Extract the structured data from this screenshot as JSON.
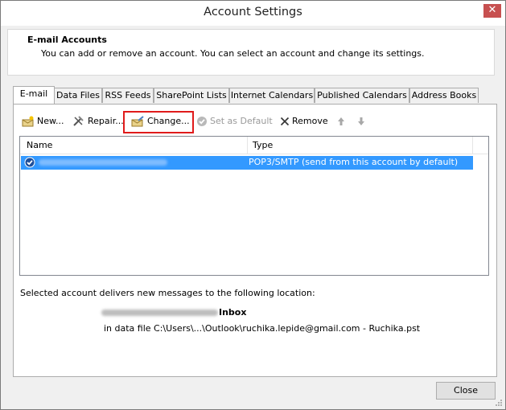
{
  "window": {
    "title": "Account Settings",
    "close_glyph": "✕"
  },
  "header": {
    "title": "E-mail Accounts",
    "description": "You can add or remove an account. You can select an account and change its settings."
  },
  "tabs": [
    {
      "label": "E-mail",
      "active": true
    },
    {
      "label": "Data Files"
    },
    {
      "label": "RSS Feeds"
    },
    {
      "label": "SharePoint Lists"
    },
    {
      "label": "Internet Calendars"
    },
    {
      "label": "Published Calendars"
    },
    {
      "label": "Address Books"
    }
  ],
  "toolbar": {
    "new_label": "New...",
    "repair_label": "Repair...",
    "change_label": "Change...",
    "set_default_label": "Set as Default",
    "remove_label": "Remove"
  },
  "accounts_list": {
    "columns": [
      "Name",
      "Type"
    ],
    "rows": [
      {
        "name": "ruchika.lepide@gmail.com",
        "type": "POP3/SMTP (send from this account by default)",
        "selected": true
      }
    ]
  },
  "delivery": {
    "text": "Selected account delivers new messages to the following location:",
    "mailbox": "ruchika.lepide@gmail.com",
    "folder": "Inbox",
    "data_file": "in data file C:\\Users\\...\\Outlook\\ruchika.lepide@gmail.com - Ruchika.pst"
  },
  "footer": {
    "close_label": "Close"
  },
  "colors": {
    "selection": "#3399ff",
    "highlight_box": "#e01b1b",
    "close_button": "#c75050"
  }
}
